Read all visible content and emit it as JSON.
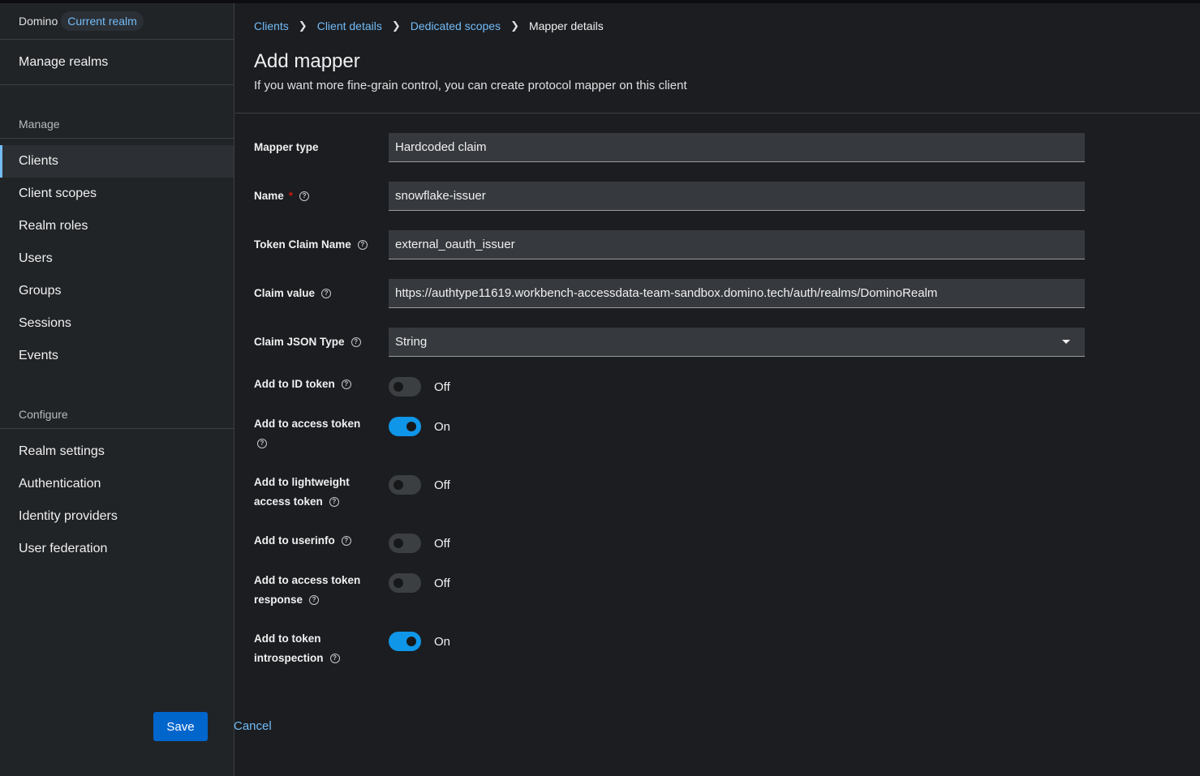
{
  "sidebar": {
    "realm_name": "Domino",
    "realm_badge": "Current realm",
    "manage_realms": "Manage realms",
    "manage_title": "Manage",
    "manage_items": [
      "Clients",
      "Client scopes",
      "Realm roles",
      "Users",
      "Groups",
      "Sessions",
      "Events"
    ],
    "configure_title": "Configure",
    "configure_items": [
      "Realm settings",
      "Authentication",
      "Identity providers",
      "User federation"
    ]
  },
  "breadcrumb": [
    "Clients",
    "Client details",
    "Dedicated scopes",
    "Mapper details"
  ],
  "header": {
    "title": "Add mapper",
    "description": "If you want more fine-grain control, you can create protocol mapper on this client"
  },
  "form": {
    "mapper_type": {
      "label": "Mapper type",
      "value": "Hardcoded claim"
    },
    "name": {
      "label": "Name",
      "required": "*",
      "value": "snowflake-issuer"
    },
    "token_claim_name": {
      "label": "Token Claim Name",
      "value": "external_oauth_issuer"
    },
    "claim_value": {
      "label": "Claim value",
      "value": "https://authtype11619.workbench-accessdata-team-sandbox.domino.tech/auth/realms/DominoRealm"
    },
    "claim_json_type": {
      "label": "Claim JSON Type",
      "value": "String"
    },
    "switches": [
      {
        "label_line1": "Add to ID token",
        "label_line2": "",
        "state": "Off"
      },
      {
        "label_line1": "Add to access token",
        "label_line2": "",
        "state": "On"
      },
      {
        "label_line1": "Add to lightweight",
        "label_line2": "access token",
        "state": "Off"
      },
      {
        "label_line1": "Add to userinfo",
        "label_line2": "",
        "state": "Off"
      },
      {
        "label_line1": "Add to access token",
        "label_line2": "response",
        "state": "Off"
      },
      {
        "label_line1": "Add to token",
        "label_line2": "introspection",
        "state": "On"
      }
    ],
    "save_label": "Save",
    "cancel_label": "Cancel"
  },
  "colors": {
    "accent": "#73bcf7",
    "primary_button": "#0066cc",
    "switch_on": "#0f96e8",
    "background": "#1b1d21",
    "sidebar": "#212427"
  }
}
